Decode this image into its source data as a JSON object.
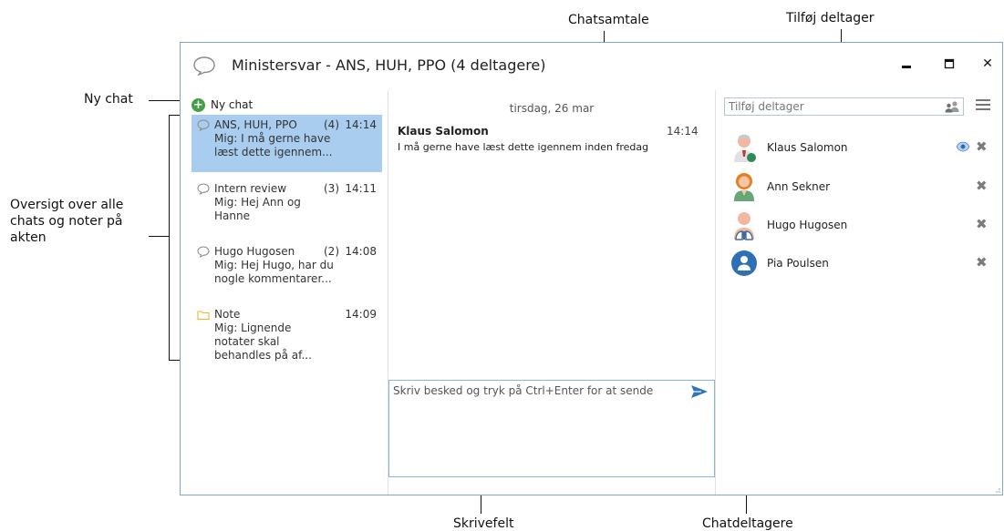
{
  "annotations": {
    "chatsamtale": "Chatsamtale",
    "tilfoej_deltager": "Tilføj deltager",
    "ny_chat": "Ny chat",
    "oversigt": [
      "Oversigt over alle",
      "chats og noter på",
      "akten"
    ],
    "skrivefelt": "Skrivefelt",
    "chatdeltagere": "Chatdeltagere"
  },
  "window": {
    "title": "Ministersvar - ANS, HUH, PPO (4 deltagere)",
    "minimize_icon": "minimize-icon",
    "maximize_icon": "maximize-icon",
    "close_label": "✕"
  },
  "left": {
    "new_chat_label": "Ny chat",
    "chats": [
      {
        "name": "ANS, HUH, PPO",
        "count": "(4)",
        "time": "14:14",
        "preview": "Mig: I må gerne have læst dette igennem...",
        "icon": "chat-bubble-icon",
        "selected": true
      },
      {
        "name": "Intern review",
        "count": "(3)",
        "time": "14:11",
        "preview": "Mig: Hej Ann og Hanne",
        "icon": "chat-bubble-icon",
        "selected": false
      },
      {
        "name": "Hugo Hugosen",
        "count": "(2)",
        "time": "14:08",
        "preview": "Mig: Hej Hugo, har du nogle kommentarer...",
        "icon": "chat-bubble-icon",
        "selected": false
      },
      {
        "name": "Note",
        "count": "",
        "time": "14:09",
        "preview": "Mig: Lignende notater skal behandles på af...",
        "icon": "folder-icon",
        "selected": false
      }
    ]
  },
  "conversation": {
    "date": "tirsdag, 26 mar",
    "messages": [
      {
        "sender": "Klaus Salomon",
        "time": "14:14",
        "text": "I må gerne have læst dette igennem inden fredag"
      }
    ],
    "compose_placeholder": "Skriv besked og tryk på Ctrl+Enter for at sende",
    "send_icon": "send-icon"
  },
  "participants": {
    "add_placeholder": "Tilføj deltager",
    "add_icon": "people-icon",
    "menu_icon": "hamburger-menu-icon",
    "list": [
      {
        "name": "Klaus Salomon",
        "avatar": "avatar-man-tie",
        "seen": true
      },
      {
        "name": "Ann Sekner",
        "avatar": "avatar-woman",
        "seen": false
      },
      {
        "name": "Hugo Hugosen",
        "avatar": "avatar-man-suit",
        "seen": false
      },
      {
        "name": "Pia Poulsen",
        "avatar": "avatar-default",
        "seen": false
      }
    ],
    "remove_label": "✖"
  },
  "colors": {
    "selected_row": "#a9cdef",
    "window_border": "#7fa6c9",
    "accent_blue": "#2f75b5",
    "add_green": "#43a047"
  }
}
